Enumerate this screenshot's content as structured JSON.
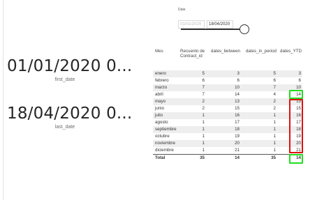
{
  "slicer": {
    "title": "Date",
    "start_date": "01/01/2020",
    "end_date": "18/04/2020",
    "slider_position": 1.0
  },
  "cards": [
    {
      "value": "01/01/2020 0...",
      "label": "first_date"
    },
    {
      "value": "18/04/2020 0...",
      "label": "last_date"
    }
  ],
  "table": {
    "headers": {
      "mes": "Mes",
      "recuento": "Recuento de Contract_id",
      "between": "dates_between",
      "in_period": "dates_in_period",
      "ytd": "dates_YTD"
    },
    "rows": [
      {
        "mes": "enero",
        "recuento": "5",
        "between": "3",
        "in_period": "5",
        "ytd": "3"
      },
      {
        "mes": "febrero",
        "recuento": "6",
        "between": "6",
        "in_period": "6",
        "ytd": "6"
      },
      {
        "mes": "marzo",
        "recuento": "7",
        "between": "10",
        "in_period": "7",
        "ytd": "10"
      },
      {
        "mes": "abril",
        "recuento": "7",
        "between": "14",
        "in_period": "4",
        "ytd": "14"
      },
      {
        "mes": "mayo",
        "recuento": "2",
        "between": "13",
        "in_period": "2",
        "ytd": "13"
      },
      {
        "mes": "junio",
        "recuento": "2",
        "between": "15",
        "in_period": "2",
        "ytd": "15"
      },
      {
        "mes": "julio",
        "recuento": "1",
        "between": "16",
        "in_period": "1",
        "ytd": "16"
      },
      {
        "mes": "agosto",
        "recuento": "1",
        "between": "17",
        "in_period": "1",
        "ytd": "17"
      },
      {
        "mes": "septiembre",
        "recuento": "1",
        "between": "18",
        "in_period": "1",
        "ytd": "18"
      },
      {
        "mes": "octubre",
        "recuento": "1",
        "between": "19",
        "in_period": "1",
        "ytd": "19"
      },
      {
        "mes": "noviembre",
        "recuento": "1",
        "between": "20",
        "in_period": "1",
        "ytd": "20"
      },
      {
        "mes": "diciembre",
        "recuento": "1",
        "between": "21",
        "in_period": "1",
        "ytd": "21"
      }
    ],
    "total": {
      "mes": "Total",
      "recuento": "35",
      "between": "14",
      "in_period": "35",
      "ytd": "14"
    }
  },
  "colors": {
    "highlight_green": "#22dd22",
    "highlight_red": "#e01010"
  }
}
